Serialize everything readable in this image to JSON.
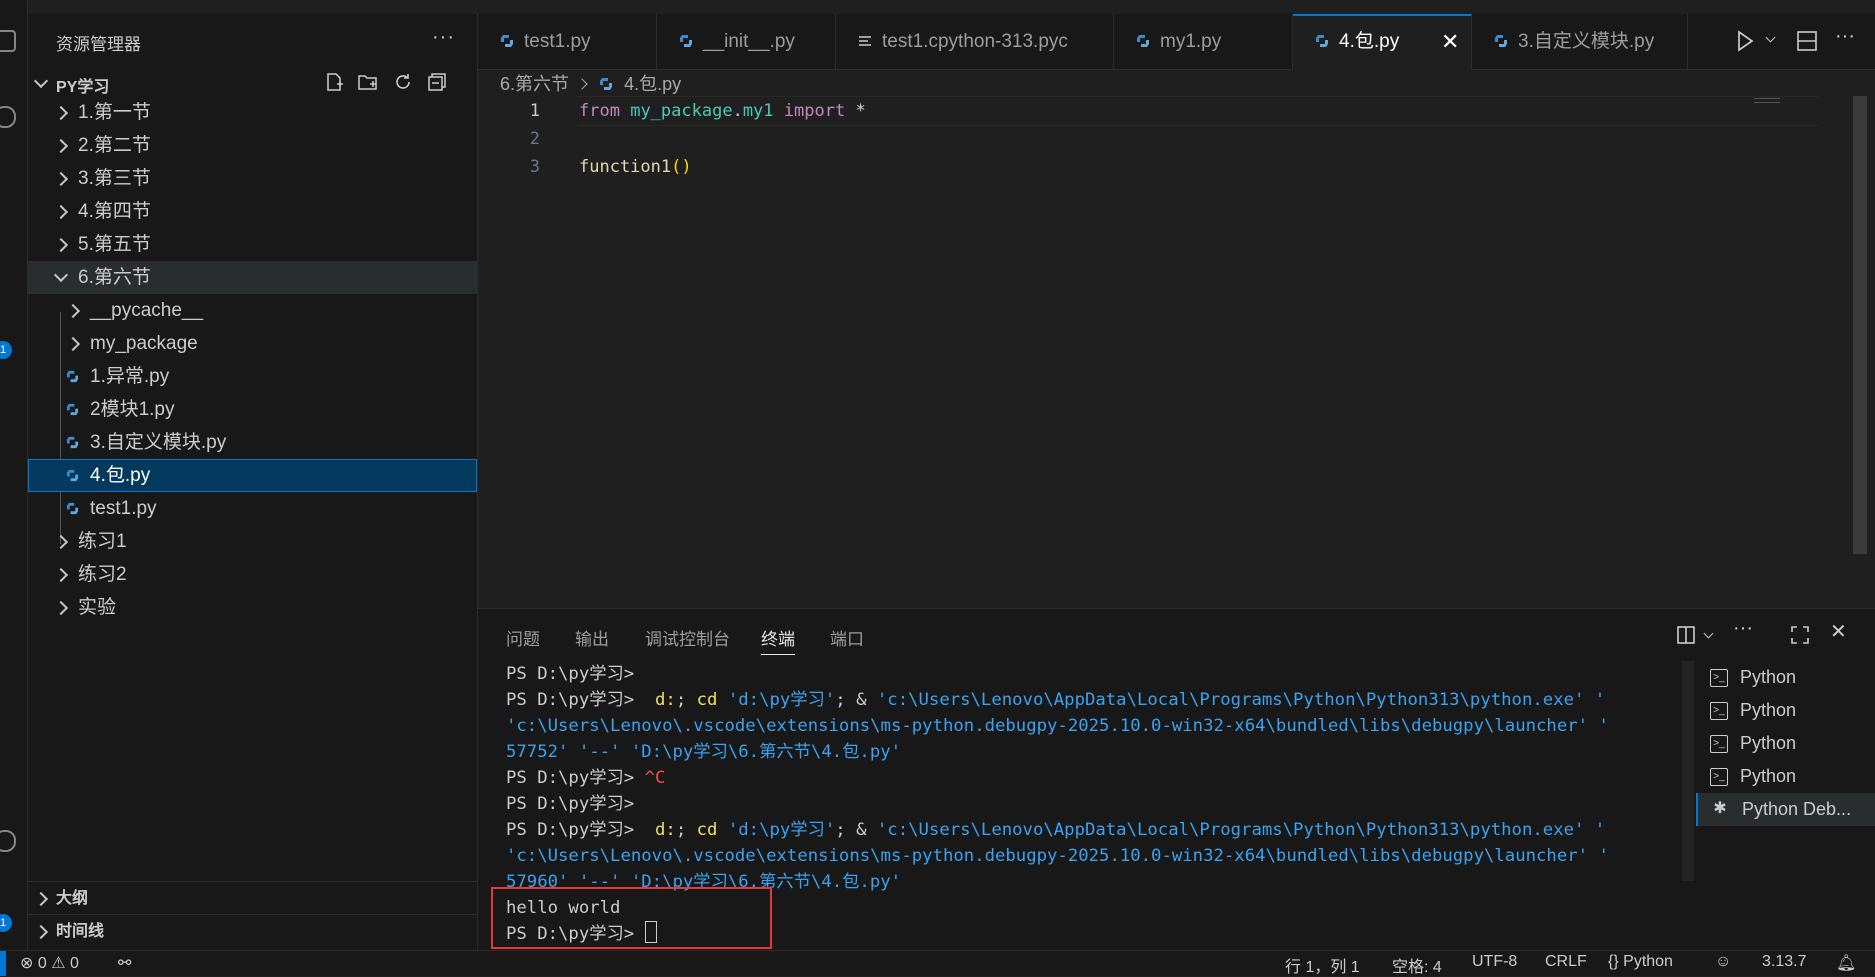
{
  "sidebar": {
    "title": "资源管理器",
    "more": "···",
    "folder": "PY学习",
    "tree": [
      {
        "label": "1.第一节",
        "type": "folder"
      },
      {
        "label": "2.第二节",
        "type": "folder"
      },
      {
        "label": "3.第三节",
        "type": "folder"
      },
      {
        "label": "4.第四节",
        "type": "folder"
      },
      {
        "label": "5.第五节",
        "type": "folder"
      },
      {
        "label": "6.第六节",
        "type": "folder-open"
      },
      {
        "label": "__pycache__",
        "type": "subfolder"
      },
      {
        "label": "my_package",
        "type": "subfolder"
      },
      {
        "label": "1.异常.py",
        "type": "file"
      },
      {
        "label": "2模块1.py",
        "type": "file"
      },
      {
        "label": "3.自定义模块.py",
        "type": "file"
      },
      {
        "label": "4.包.py",
        "type": "file-selected"
      },
      {
        "label": "test1.py",
        "type": "file"
      },
      {
        "label": "练习1",
        "type": "folder"
      },
      {
        "label": "练习2",
        "type": "folder"
      },
      {
        "label": "实验",
        "type": "folder"
      }
    ],
    "outline": "大纲",
    "timeline": "时间线"
  },
  "tabs": [
    {
      "label": "test1.py",
      "icon": "python-icon"
    },
    {
      "label": "__init__.py",
      "icon": "python-icon"
    },
    {
      "label": "test1.cpython-313.pyc",
      "icon": "lines-icon"
    },
    {
      "label": "my1.py",
      "icon": "python-icon"
    },
    {
      "label": "4.包.py",
      "icon": "python-icon",
      "active": true
    },
    {
      "label": "3.自定义模块.py",
      "icon": "python-icon"
    }
  ],
  "breadcrumb": {
    "folder": "6.第六节",
    "file": "4.包.py"
  },
  "editor": {
    "lines": [
      {
        "num": "1",
        "kw_from": "from",
        "module": "my_package",
        "dot": ".",
        "sub": "my1",
        "kw_import": "import",
        "star": "*"
      },
      {
        "num": "2"
      },
      {
        "num": "3",
        "fn": "function1",
        "parens": "()"
      }
    ]
  },
  "panel": {
    "tabs": [
      "问题",
      "输出",
      "调试控制台",
      "终端",
      "端口"
    ],
    "active_tab": "终端",
    "terminal": {
      "prompt": "PS D:\\py学习>",
      "cmd_d": "d:",
      "cmd_cd": "cd",
      "cd_path": "'d:\\py学习'",
      "amp": "&",
      "python_exe": "'c:\\Users\\Lenovo\\AppData\\Local\\Programs\\Python\\Python313\\python.exe'",
      "launcher": "'c:\\Users\\Lenovo\\.vscode\\extensions\\ms-python.debugpy-2025.10.0-win32-x64\\bundled\\libs\\debugpy\\launcher'",
      "port1": "57752",
      "port2": "57960",
      "dashes": "'--'",
      "script": "'D:\\py学习\\6.第六节\\4.包.py'",
      "ctrl_c": "^C",
      "output": "hello world"
    },
    "terminal_list": [
      "Python",
      "Python",
      "Python",
      "Python",
      "Python Deb..."
    ]
  },
  "statusbar": {
    "errors": "0",
    "warnings": "0",
    "position": "行 1，列 1",
    "spaces": "空格: 4",
    "encoding": "UTF-8",
    "eol": "CRLF",
    "language": "Python",
    "lang_prefix": "{}",
    "version": "3.13.7"
  },
  "colors": {
    "accent": "#0078d4",
    "keyword": "#c586c0",
    "module": "#4ec9b0",
    "function": "#dcdcaa",
    "highlight_box": "#e5393b"
  }
}
